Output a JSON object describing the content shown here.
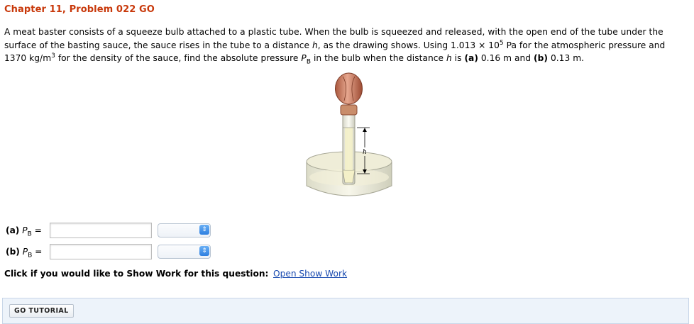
{
  "header": {
    "title": "Chapter 11, Problem 022 GO"
  },
  "problem": {
    "intro": "A meat baster consists of a squeeze bulb attached to a plastic tube. When the bulb is squeezed and released, with the open end of the tube under the surface of the basting sauce, the sauce rises in the tube to a distance ",
    "var_h": "h",
    "mid1": ", as the drawing shows. Using 1.013 × 10",
    "exp_5": "5",
    "mid2": " Pa for the atmospheric pressure and 1370 kg/m",
    "exp_3": "3",
    "mid3": " for the density of the sauce, find the absolute pressure ",
    "var_P": "P",
    "sub_B": "B",
    "mid4": " in the bulb when the distance ",
    "var_h2": "h",
    "mid5": " is ",
    "part_a": "(a)",
    "val_a": " 0.16 m and ",
    "part_b": "(b)",
    "val_b": " 0.13 m."
  },
  "figure": {
    "h_label": "h"
  },
  "answers": [
    {
      "part": "(a)",
      "var": "P",
      "sub": "B",
      "eq": "=",
      "value": "",
      "unit": ""
    },
    {
      "part": "(b)",
      "var": "P",
      "sub": "B",
      "eq": "=",
      "value": "",
      "unit": ""
    }
  ],
  "show_work": {
    "prompt": "Click if you would like to Show Work for this question:",
    "link": "Open Show Work"
  },
  "tutorial": {
    "button": "GO TUTORIAL"
  }
}
